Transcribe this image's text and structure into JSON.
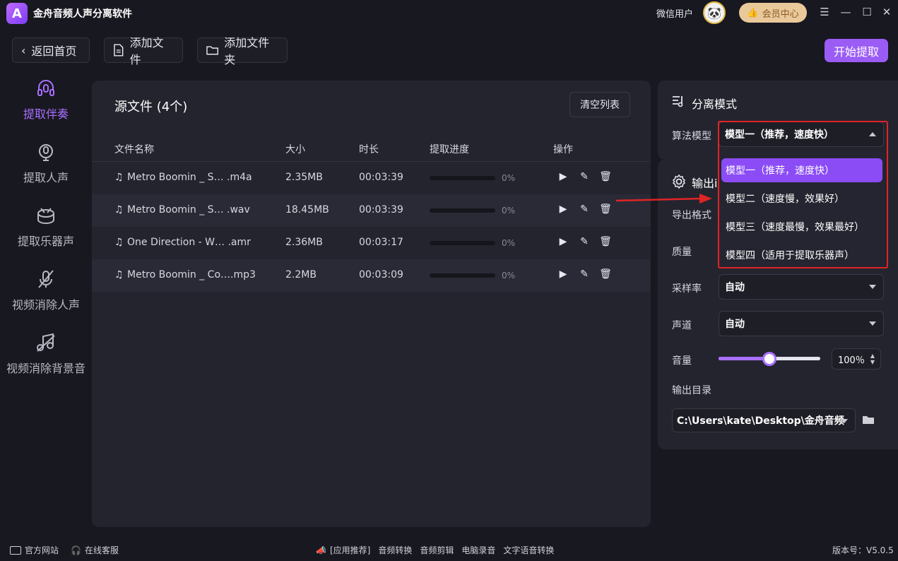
{
  "app": {
    "title": "金舟音频人声分离软件",
    "logo_glyph": "A",
    "user": "微信用户",
    "vip_label": "会员中心"
  },
  "toolbar": {
    "back": "返回首页",
    "add_file": "添加文件",
    "add_folder": "添加文件夹",
    "start": "开始提取"
  },
  "sidebar": [
    {
      "label": "提取伴奏",
      "icon": "headphones-icon",
      "active": true
    },
    {
      "label": "提取人声",
      "icon": "microphone-icon"
    },
    {
      "label": "提取乐器声",
      "icon": "drum-icon"
    },
    {
      "label": "视频消除人声",
      "icon": "mute-mic-icon"
    },
    {
      "label": "视频消除背景音",
      "icon": "music-note-off-icon"
    }
  ],
  "file_panel": {
    "title": "源文件 (4个)",
    "clear": "清空列表",
    "headers": {
      "name": "文件名称",
      "size": "大小",
      "duration": "时长",
      "progress": "提取进度",
      "ops": "操作"
    },
    "rows": [
      {
        "name": "Metro Boomin _ S…  .m4a",
        "size": "2.35MB",
        "duration": "00:03:39",
        "pct": "0%"
      },
      {
        "name": "Metro Boomin _ S…  .wav",
        "size": "18.45MB",
        "duration": "00:03:39",
        "pct": "0%"
      },
      {
        "name": "One Direction - W…  .amr",
        "size": "2.36MB",
        "duration": "00:03:17",
        "pct": "0%"
      },
      {
        "name": "Metro Boomin _ Co….mp3",
        "size": "2.2MB",
        "duration": "00:03:09",
        "pct": "0%"
      }
    ]
  },
  "separation": {
    "title": "分离模式",
    "algo_label": "算法模型",
    "selected": "模型一（推荐，速度快）",
    "options": [
      "模型一（推荐，速度快）",
      "模型二（速度慢，效果好）",
      "模型三（速度最慢，效果最好）",
      "模型四（适用于提取乐器声）"
    ]
  },
  "output": {
    "title_visible": "输出i",
    "format_label": "导出格式",
    "quality_label": "质量",
    "samplerate_label": "采样率",
    "samplerate_value": "自动",
    "channel_label": "声道",
    "channel_value": "自动",
    "volume_label": "音量",
    "volume_value": "100％",
    "volume_level": 0.5,
    "dir_label": "输出目录",
    "dir_value": "C:\\Users\\kate\\Desktop\\金舟音频"
  },
  "footer": {
    "website": "官方网站",
    "support": "在线客服",
    "promo": "[应用推荐]",
    "links": [
      "音频转换",
      "音频剪辑",
      "电脑录音",
      "文字语音转换"
    ],
    "version": "版本号：V5.0.5"
  },
  "colors": {
    "accent": "#9b5cf6",
    "annotation": "#e02424"
  }
}
